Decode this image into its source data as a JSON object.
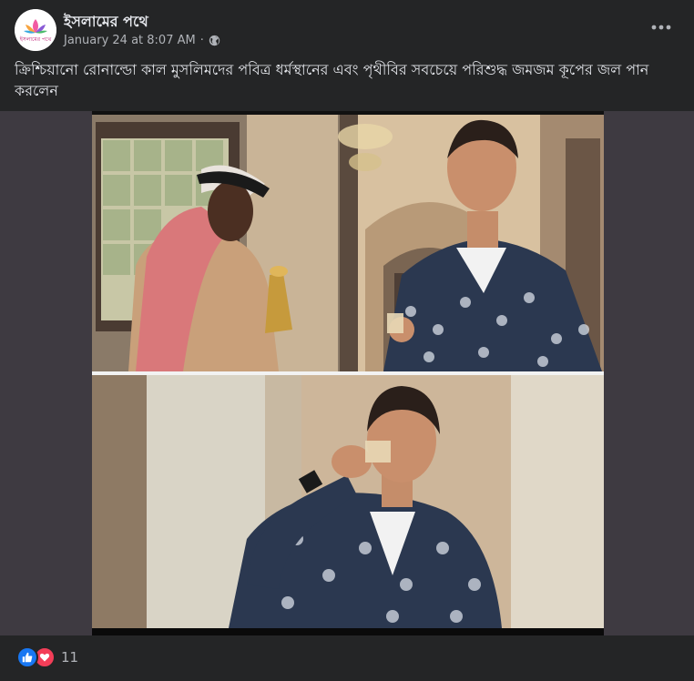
{
  "page": {
    "name": "ইসলামের পথে",
    "timestamp": "January 24 at 8:07 AM",
    "separator": "·",
    "avatar_text": "ইসলামের পথে"
  },
  "post": {
    "text": "ক্রিশ্চিয়ানো রোনাল্ডো কাল মুসলিমদের পবিত্র ধর্মস্থানের এবং পৃথীবির সবচেয়ে পরিশুদ্ধ জমজম কূপের জল পান করলেন"
  },
  "icons": {
    "globe": "globe-icon",
    "more": "more-options-icon",
    "like": "like-icon",
    "love": "love-icon"
  },
  "reactions": {
    "count": "11"
  },
  "colors": {
    "background": "#242526",
    "media_background": "#3e3a41",
    "like": "#1877f2",
    "love": "#f33e58"
  }
}
